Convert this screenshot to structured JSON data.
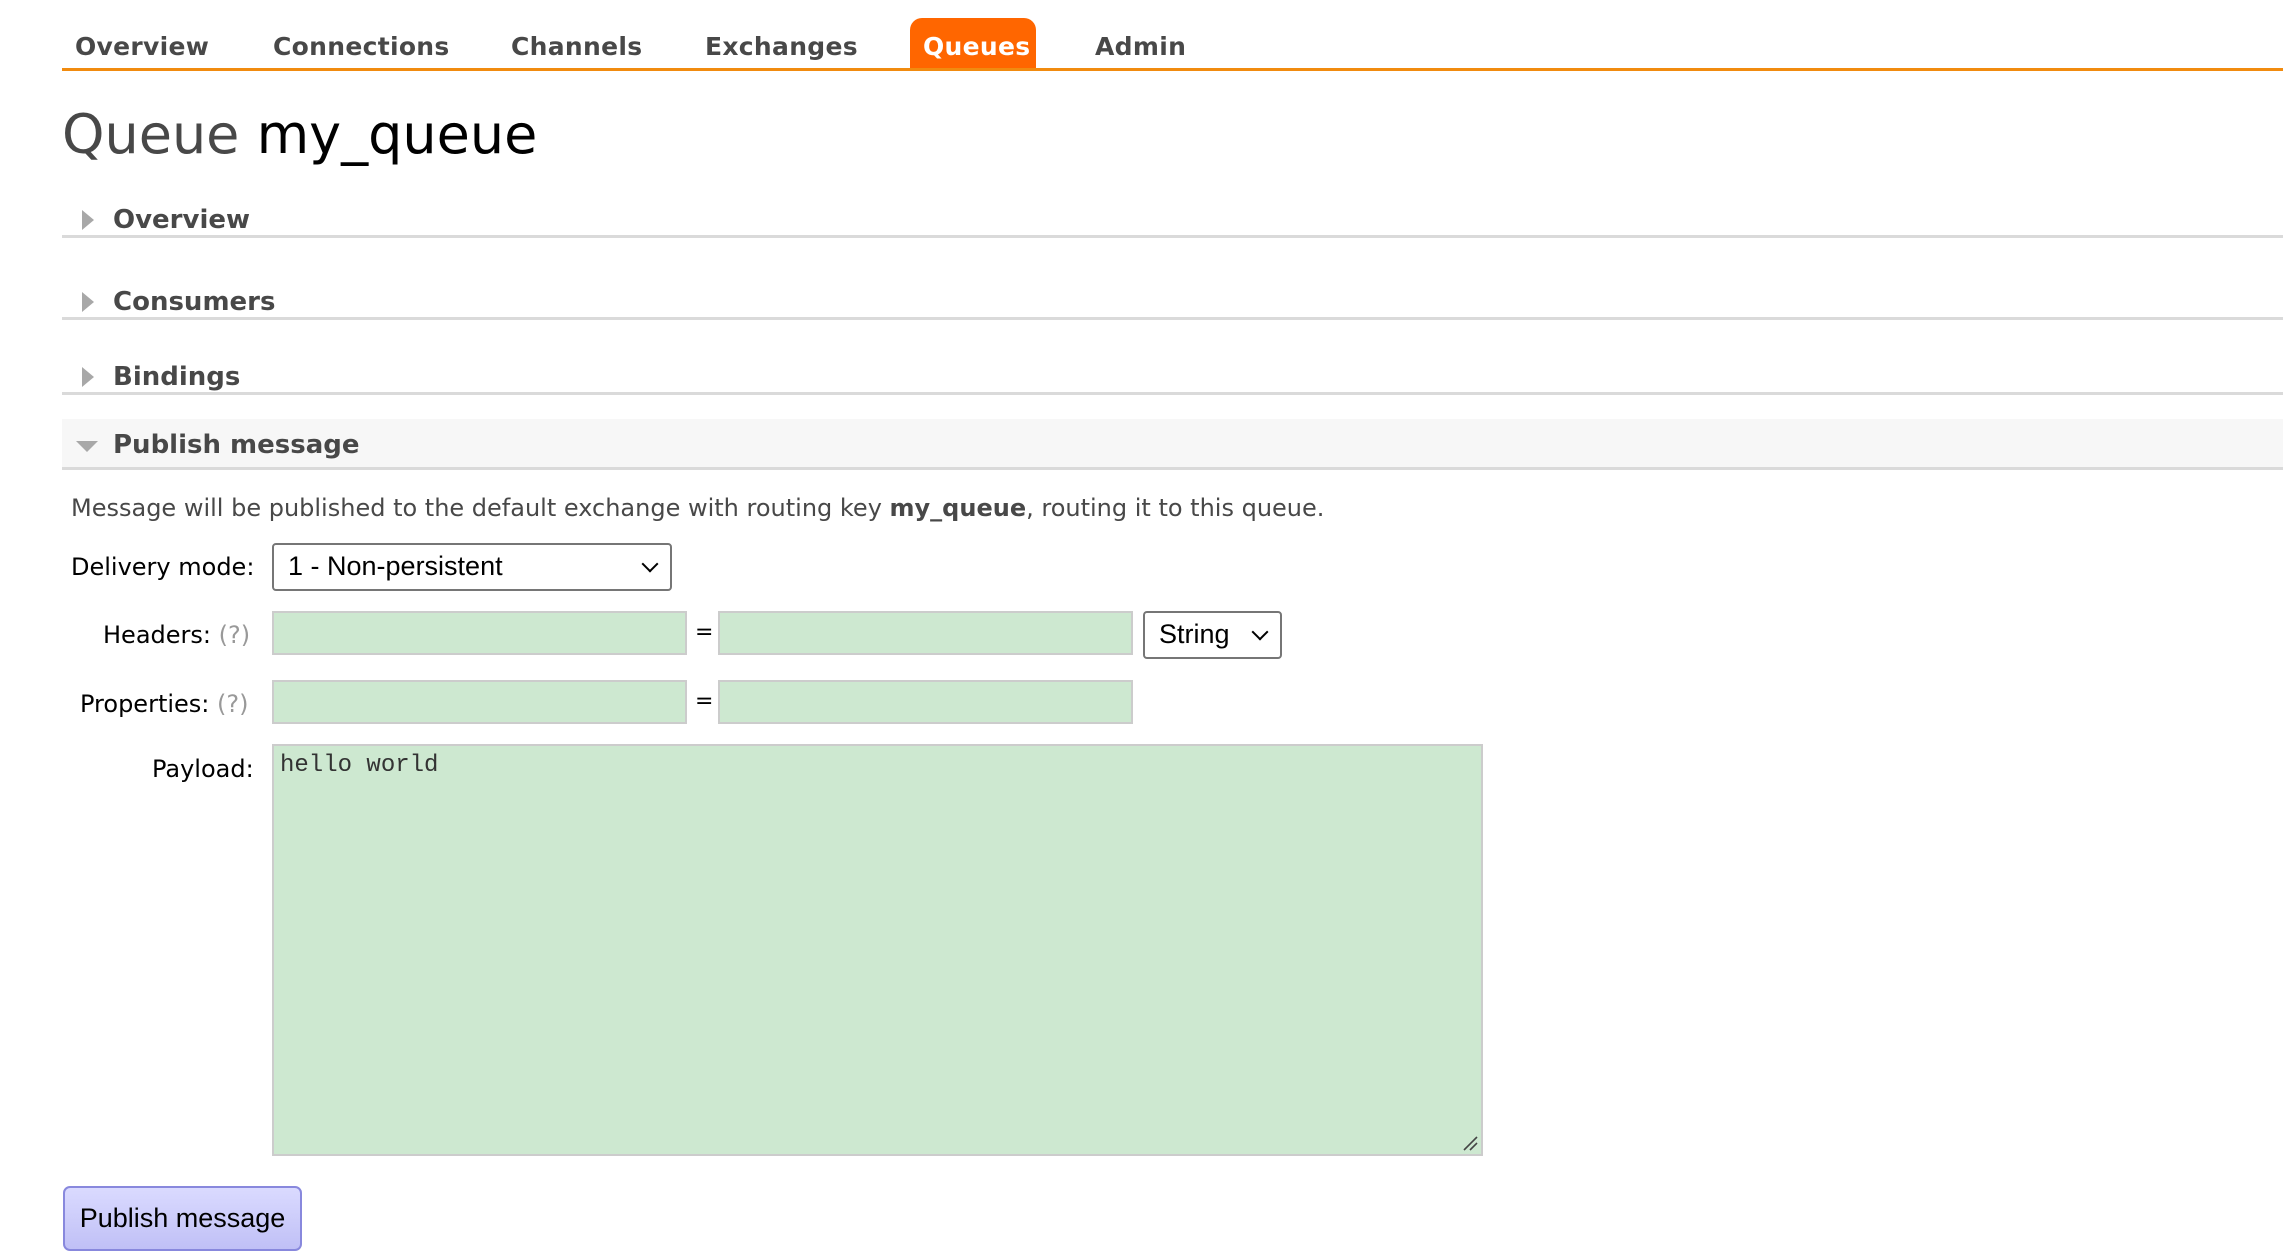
{
  "nav": {
    "tabs": [
      {
        "label": "Overview",
        "active": false
      },
      {
        "label": "Connections",
        "active": false
      },
      {
        "label": "Channels",
        "active": false
      },
      {
        "label": "Exchanges",
        "active": false
      },
      {
        "label": "Queues",
        "active": true
      },
      {
        "label": "Admin",
        "active": false
      }
    ],
    "accent_color": "#ff6600",
    "underline_color": "#f18b0f"
  },
  "page": {
    "title_prefix": "Queue",
    "queue_name": "my_queue"
  },
  "sections": [
    {
      "label": "Overview",
      "expanded": false
    },
    {
      "label": "Consumers",
      "expanded": false
    },
    {
      "label": "Bindings",
      "expanded": false
    },
    {
      "label": "Publish message",
      "expanded": true
    }
  ],
  "publish": {
    "description_before": "Message will be published to the default exchange with routing key ",
    "routing_key": "my_queue",
    "description_after": ", routing it to this queue.",
    "delivery_mode_label": "Delivery mode:",
    "delivery_mode_value": "1 - Non-persistent",
    "headers_label": "Headers:",
    "properties_label": "Properties:",
    "help_marker": "(?)",
    "equals": "=",
    "headers_key": "",
    "headers_value": "",
    "headers_type": "String",
    "properties_key": "",
    "properties_value": "",
    "payload_label": "Payload:",
    "payload_value": "hello world",
    "submit_label": "Publish message",
    "input_bg_color": "#cde8d0"
  }
}
